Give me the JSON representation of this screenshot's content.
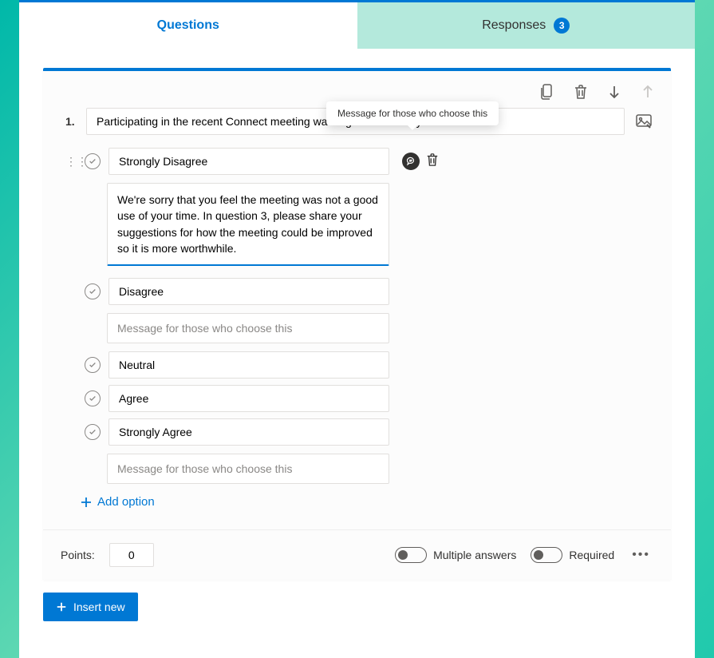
{
  "tabs": {
    "questions": "Questions",
    "responses": "Responses",
    "response_count": "3"
  },
  "tooltip": "Message for those who choose this",
  "question": {
    "number": "1.",
    "text": "Participating in the recent Connect meeting was a good use of my time."
  },
  "options": [
    {
      "label": "Strongly Disagree",
      "message": "We're sorry that you feel the meeting was not a good use of your time. In question 3, please share your suggestions for how the meeting could be improved so it is more worthwhile."
    },
    {
      "label": "Disagree",
      "placeholder": "Message for those who choose this"
    },
    {
      "label": "Neutral"
    },
    {
      "label": "Agree"
    },
    {
      "label": "Strongly Agree",
      "placeholder": "Message for those who choose this"
    }
  ],
  "add_option": "Add option",
  "footer": {
    "points_label": "Points:",
    "points_value": "0",
    "multiple_answers": "Multiple answers",
    "required": "Required"
  },
  "insert_new": "Insert new"
}
